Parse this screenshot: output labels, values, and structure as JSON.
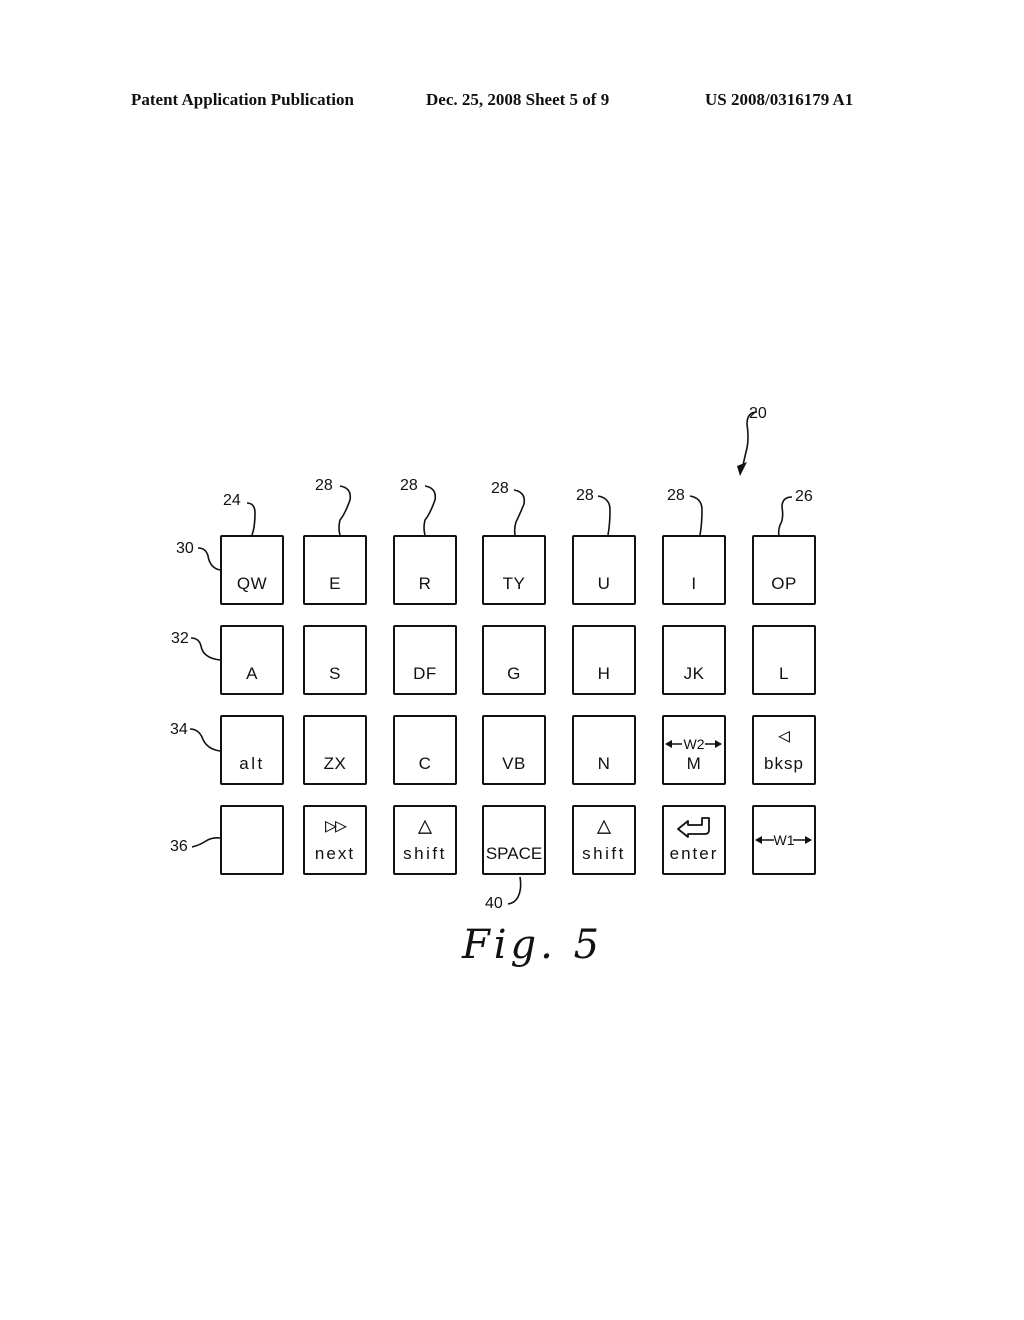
{
  "header": {
    "left": "Patent Application Publication",
    "middle": "Dec. 25, 2008   Sheet 5 of 9",
    "right": "US 2008/0316179 A1"
  },
  "figure": {
    "caption": "Fig. 5",
    "device_ref": "20",
    "rows": [
      {
        "ref": "30",
        "keys": [
          {
            "label": "QW",
            "ref": "24"
          },
          {
            "label": "E",
            "ref": "28"
          },
          {
            "label": "R",
            "ref": "28"
          },
          {
            "label": "TY",
            "ref": "28"
          },
          {
            "label": "U",
            "ref": "28"
          },
          {
            "label": "I",
            "ref": "28"
          },
          {
            "label": "OP",
            "ref": "26"
          }
        ]
      },
      {
        "ref": "32",
        "keys": [
          {
            "label": "A"
          },
          {
            "label": "S"
          },
          {
            "label": "DF"
          },
          {
            "label": "G"
          },
          {
            "label": "H"
          },
          {
            "label": "JK"
          },
          {
            "label": "L"
          }
        ]
      },
      {
        "ref": "34",
        "keys": [
          {
            "label": "alt"
          },
          {
            "label": "ZX"
          },
          {
            "label": "C"
          },
          {
            "label": "VB"
          },
          {
            "label": "N"
          },
          {
            "label": "M",
            "dimension": "W2"
          },
          {
            "label": "bksp",
            "icon": "backspace-triangle-icon",
            "glyph": "◁"
          }
        ]
      },
      {
        "ref": "36",
        "keys": [
          {
            "label": ""
          },
          {
            "label": "next",
            "icon": "double-triangle-icon",
            "glyph": "▷▷"
          },
          {
            "label": "shift",
            "icon": "up-triangle-icon",
            "glyph": "△"
          },
          {
            "label": "SPACE",
            "ref": "40"
          },
          {
            "label": "shift",
            "icon": "up-triangle-icon",
            "glyph": "△"
          },
          {
            "label": "enter",
            "icon": "return-arrow-icon",
            "glyph": "⇦"
          },
          {
            "label": "",
            "dimension": "W1"
          }
        ]
      }
    ]
  }
}
